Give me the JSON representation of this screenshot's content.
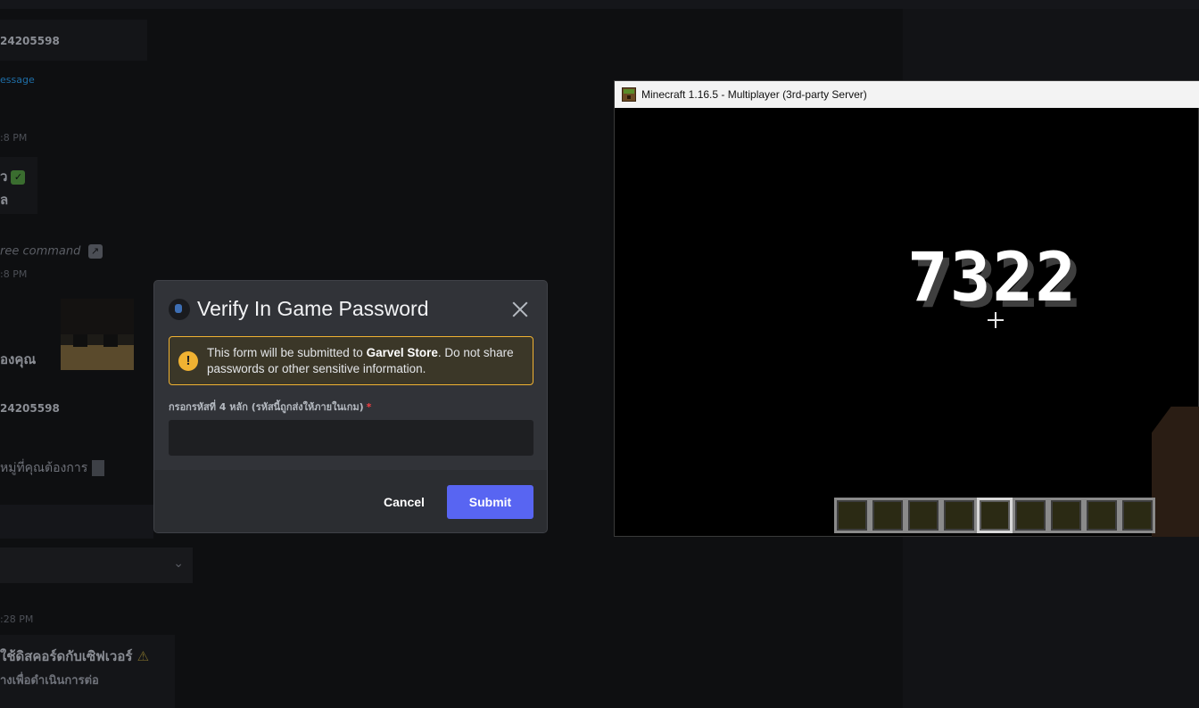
{
  "background_chat": {
    "user_id_1": "24205598",
    "message_link": "essage",
    "time_1": ":8 PM",
    "line_1": "ว",
    "line_2": "ล",
    "command_text": "ree command",
    "time_2": ":8 PM",
    "thai_label": "องคุณ",
    "user_id_2": "24205598",
    "category_text": "หมู่ที่คุณต้องการ",
    "time_3": ":28 PM",
    "warning_text": "ใช้ดิสคอร์ดกับเซิฟเวอร์",
    "continue_text": "างเพื่อดำเนินการต่อ"
  },
  "minecraft": {
    "window_title": "Minecraft 1.16.5 - Multiplayer (3rd-party Server)",
    "code": "7322",
    "hotbar_slots": 9,
    "selected_slot": 5
  },
  "modal": {
    "title": "Verify In Game Password",
    "notice_prefix": "This form will be submitted to ",
    "notice_app": "Garvel Store",
    "notice_suffix": ". Do not share passwords or other sensitive information.",
    "notice_icon": "!",
    "field_label": "กรอกรหัสที่ 4 หลัก (รหัสนี้ถูกส่งให้ภายในเกม)",
    "required_mark": "*",
    "field_value": "",
    "cancel_label": "Cancel",
    "submit_label": "Submit"
  },
  "colors": {
    "accent": "#5865f2",
    "warning": "#f0b232",
    "required": "#f23f43"
  }
}
